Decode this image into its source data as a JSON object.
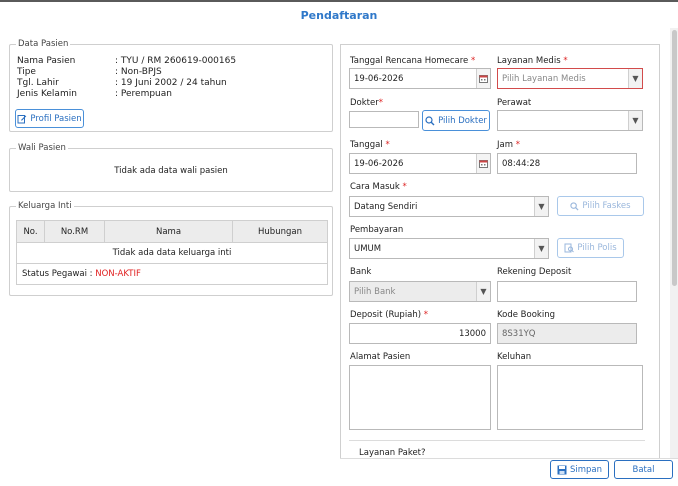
{
  "dialog": {
    "title": "Pendaftaran"
  },
  "data_pasien": {
    "legend": "Data Pasien",
    "rows": [
      {
        "label": "Nama Pasien",
        "value": ": TYU / RM 260619-000165"
      },
      {
        "label": "Tipe",
        "value": ": Non-BPJS"
      },
      {
        "label": "Tgl. Lahir",
        "value": ": 19 Juni 2002 / 24 tahun"
      },
      {
        "label": "Jenis Kelamin",
        "value": ": Perempuan"
      }
    ],
    "profile_button": "Profil Pasien"
  },
  "wali_pasien": {
    "legend": "Wali Pasien",
    "empty_text": "Tidak ada data wali pasien"
  },
  "keluarga_inti": {
    "legend": "Keluarga Inti",
    "columns": [
      "No.",
      "No.RM",
      "Nama",
      "Hubungan"
    ],
    "empty_text": "Tidak ada data keluarga inti",
    "status_label": "Status Pegawai :",
    "status_value": "NON-AKTIF",
    "status_color": "#e02020"
  },
  "form": {
    "tanggal_rencana": {
      "label": "Tanggal Rencana Homecare",
      "value": "19-06-2026"
    },
    "layanan_medis": {
      "label": "Layanan Medis",
      "placeholder": "Pilih Layanan Medis"
    },
    "dokter": {
      "label": "Dokter",
      "value": "",
      "button": "Pilih Dokter"
    },
    "perawat": {
      "label": "Perawat",
      "value": ""
    },
    "tanggal": {
      "label": "Tanggal",
      "value": "19-06-2026"
    },
    "jam": {
      "label": "Jam",
      "value": "08:44:28"
    },
    "cara_masuk": {
      "label": "Cara Masuk",
      "value": "Datang Sendiri",
      "button": "Pilih Faskes"
    },
    "pembayaran": {
      "label": "Pembayaran",
      "value": "UMUM",
      "button": "Pilih Polis"
    },
    "bank": {
      "label": "Bank",
      "placeholder": "Pilih Bank"
    },
    "rekening_deposit": {
      "label": "Rekening Deposit",
      "value": ""
    },
    "deposit": {
      "label": "Deposit (Rupiah)",
      "value": "13000"
    },
    "kode_booking": {
      "label": "Kode Booking",
      "value": "8S31YQ"
    },
    "alamat_pasien": {
      "label": "Alamat Pasien"
    },
    "keluhan": {
      "label": "Keluhan"
    },
    "layanan_paket": {
      "label": "Layanan Paket?"
    },
    "required_mark": "*"
  },
  "footer": {
    "save_button": "Simpan",
    "cancel_button": "Batal"
  },
  "colors": {
    "accent": "#2f78c9",
    "required": "#d22222",
    "error_border": "#d24b4b"
  }
}
